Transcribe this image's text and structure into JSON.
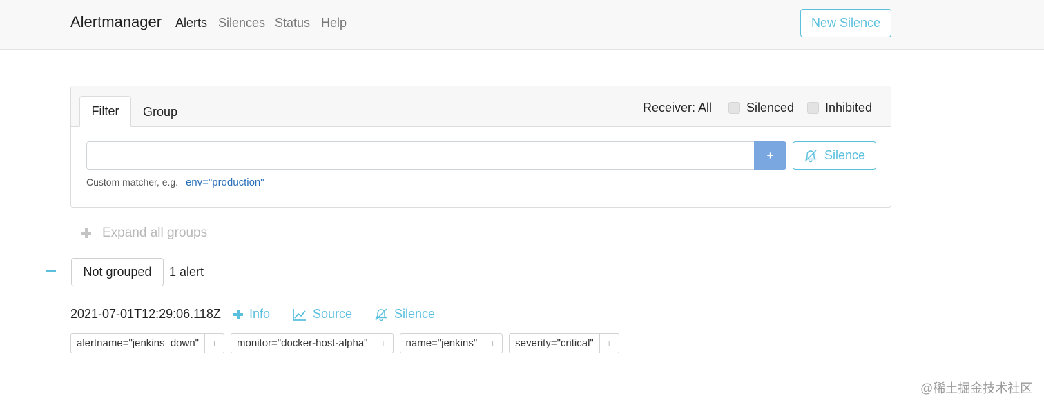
{
  "navbar": {
    "brand": "Alertmanager",
    "links": [
      "Alerts",
      "Silences",
      "Status",
      "Help"
    ],
    "new_silence": "New Silence"
  },
  "filter_card": {
    "tabs": [
      "Filter",
      "Group"
    ],
    "receiver": "Receiver: All",
    "silenced": "Silenced",
    "inhibited": "Inhibited",
    "input_value": "",
    "add_button": "+",
    "silence_button": "Silence",
    "hint": "Custom matcher, e.g.",
    "hint_example": "env=\"production\""
  },
  "groups": {
    "expand_all": "Expand all groups",
    "group_name": "Not grouped",
    "alert_count": "1 alert"
  },
  "alert": {
    "timestamp": "2021-07-01T12:29:06.118Z",
    "info": "Info",
    "source": "Source",
    "silence": "Silence",
    "labels": [
      "alertname=\"jenkins_down\"",
      "monitor=\"docker-host-alpha\"",
      "name=\"jenkins\"",
      "severity=\"critical\""
    ]
  },
  "watermark": "@稀土掘金技术社区",
  "colors": {
    "accent": "#5bc0de",
    "primary": "#7ba7e1",
    "link": "#2a6fb8"
  },
  "icons": [
    "plus-icon",
    "chart-line-icon",
    "bell-slash-icon",
    "minus-icon"
  ]
}
